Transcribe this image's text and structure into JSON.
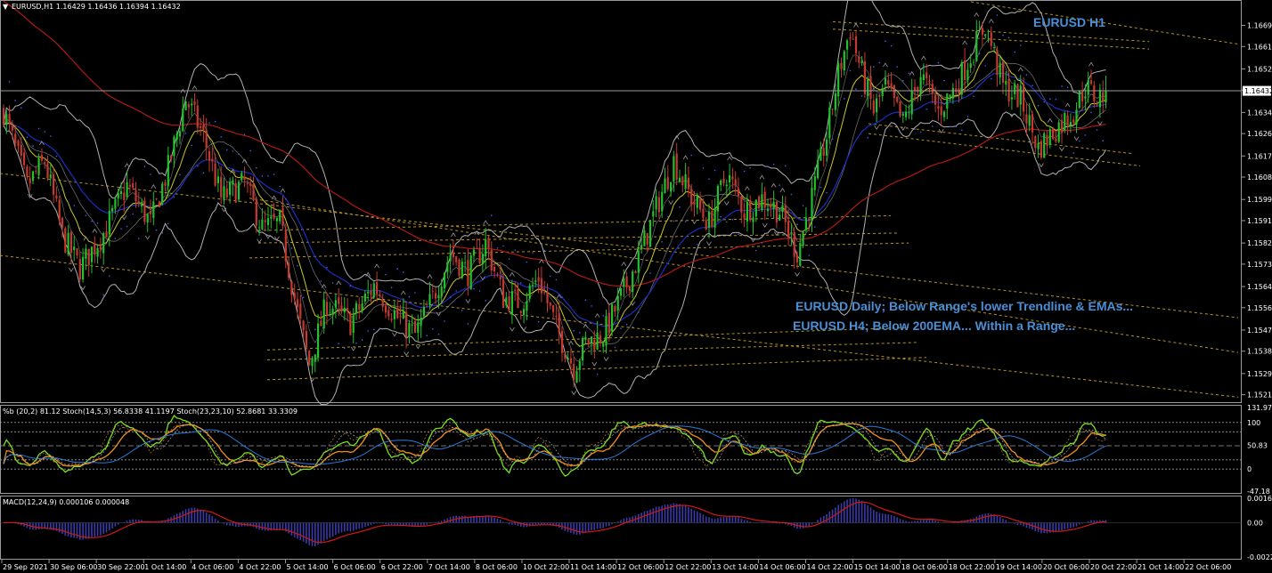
{
  "header": {
    "symbol_line": "EURUSD,H1  1.16429 1.16436 1.16394 1.16432",
    "menu_icon": "triangle-down-icon"
  },
  "colors": {
    "background": "#000000",
    "bull": "#22c02a",
    "bear": "#c43a2f",
    "ema_slow": "#b01818",
    "ema_mid": "#1a2fc0",
    "ema_fast": "#c8c820",
    "bands": "#b0b0b0",
    "trend": "#c9a227",
    "annotation": "#4a8fd6",
    "macd_hist": "#3a3aa8",
    "macd_signal": "#d01818",
    "stoch_fast": "#7ae01c",
    "stoch_slow": "#f0901c",
    "pctb": "#2a7ad8"
  },
  "annotations": {
    "title": "EURUSD H1",
    "daily": "EURUSD Daily; Below Range's lower Trendline & EMAs...",
    "h4": "EURUSD H4; Below 200EMA... Within a Range..."
  },
  "chart_data": [
    {
      "type": "candlestick",
      "name": "EURUSD,H1",
      "current_price": 1.16432,
      "current_price_label": "1.16432",
      "yticks": [
        1.16695,
        1.1661,
        1.1652,
        1.16435,
        1.16345,
        1.1626,
        1.1617,
        1.16085,
        1.15995,
        1.1591,
        1.1582,
        1.15735,
        1.15645,
        1.1556,
        1.1547,
        1.15385,
        1.15295,
        1.1521
      ],
      "ytick_labels": [
        "1.16695",
        "1.16610",
        "1.16520",
        "1.16435",
        "1.16345",
        "1.16260",
        "1.16170",
        "1.16085",
        "1.15995",
        "1.15910",
        "1.15820",
        "1.15735",
        "1.15645",
        "1.15560",
        "1.15470",
        "1.15385",
        "1.15295",
        "1.15210"
      ],
      "ylim": [
        1.1518,
        1.1679
      ],
      "xticks": [
        "29 Sep 2021",
        "30 Sep 06:00",
        "30 Sep 22:00",
        "1 Oct 14:00",
        "4 Oct 06:00",
        "4 Oct 22:00",
        "5 Oct 14:00",
        "6 Oct 06:00",
        "6 Oct 22:00",
        "7 Oct 14:00",
        "8 Oct 06:00",
        "10 Oct 22:00",
        "11 Oct 14:00",
        "12 Oct 06:00",
        "12 Oct 22:00",
        "13 Oct 14:00",
        "14 Oct 06:00",
        "14 Oct 22:00",
        "15 Oct 14:00",
        "18 Oct 06:00",
        "18 Oct 22:00",
        "19 Oct 14:00",
        "20 Oct 06:00",
        "20 Oct 22:00",
        "21 Oct 14:00",
        "22 Oct 06:00"
      ],
      "path_keypoints": [
        [
          0,
          1.1635
        ],
        [
          8,
          1.1605
        ],
        [
          14,
          1.1615
        ],
        [
          20,
          1.1585
        ],
        [
          26,
          1.1572
        ],
        [
          34,
          1.1586
        ],
        [
          42,
          1.1605
        ],
        [
          50,
          1.159
        ],
        [
          56,
          1.1612
        ],
        [
          62,
          1.164
        ],
        [
          68,
          1.1625
        ],
        [
          74,
          1.16
        ],
        [
          82,
          1.1606
        ],
        [
          88,
          1.1588
        ],
        [
          94,
          1.159
        ],
        [
          100,
          1.1554
        ],
        [
          104,
          1.1533
        ],
        [
          110,
          1.1558
        ],
        [
          118,
          1.155
        ],
        [
          126,
          1.1565
        ],
        [
          134,
          1.1552
        ],
        [
          140,
          1.1545
        ],
        [
          146,
          1.156
        ],
        [
          152,
          1.1578
        ],
        [
          158,
          1.157
        ],
        [
          164,
          1.1582
        ],
        [
          170,
          1.156
        ],
        [
          176,
          1.1558
        ],
        [
          182,
          1.1568
        ],
        [
          188,
          1.1548
        ],
        [
          194,
          1.1532
        ],
        [
          198,
          1.1542
        ],
        [
          204,
          1.1545
        ],
        [
          210,
          1.156
        ],
        [
          216,
          1.1576
        ],
        [
          222,
          1.1596
        ],
        [
          228,
          1.1615
        ],
        [
          234,
          1.16
        ],
        [
          240,
          1.159
        ],
        [
          246,
          1.161
        ],
        [
          252,
          1.1595
        ],
        [
          258,
          1.16
        ],
        [
          264,
          1.1595
        ],
        [
          270,
          1.1578
        ],
        [
          276,
          1.1605
        ],
        [
          280,
          1.1625
        ],
        [
          284,
          1.165
        ],
        [
          288,
          1.1668
        ],
        [
          292,
          1.165
        ],
        [
          296,
          1.1635
        ],
        [
          300,
          1.1645
        ],
        [
          306,
          1.163
        ],
        [
          312,
          1.165
        ],
        [
          318,
          1.1635
        ],
        [
          324,
          1.1645
        ],
        [
          330,
          1.166
        ],
        [
          334,
          1.167
        ],
        [
          340,
          1.1645
        ],
        [
          346,
          1.164
        ],
        [
          352,
          1.162
        ],
        [
          358,
          1.1628
        ],
        [
          364,
          1.1635
        ],
        [
          368,
          1.1645
        ],
        [
          372,
          1.164
        ],
        [
          375,
          1.16432
        ]
      ],
      "indicators": [
        "EMA slow (red)",
        "EMA mid (blue)",
        "EMA fast (yellow)",
        "Bollinger Bands",
        "Parabolic SAR",
        "Fractals"
      ]
    },
    {
      "type": "line",
      "name": "%b (20,2) 81.12  Stoch(14,5,3) 56.8338 41.1197  Stoch(23,23,10) 52.8681 33.3309",
      "yticks": [
        131.97,
        100,
        50.83,
        0,
        -47.18
      ],
      "ytick_labels": [
        "131.97",
        "100",
        "50.83",
        "0",
        "-47.18"
      ],
      "ylim": [
        -47.18,
        131.97
      ],
      "levels": [
        100,
        80,
        50,
        20,
        0
      ]
    },
    {
      "type": "bar",
      "name": "MACD(12,24,9) 0.000106 0.000048",
      "yticks": [
        0.001615,
        0.0,
        -0.002259
      ],
      "ytick_labels": [
        "0.001615",
        "0.00",
        "-0.002259"
      ],
      "ylim": [
        -0.002259,
        0.001615
      ]
    }
  ]
}
